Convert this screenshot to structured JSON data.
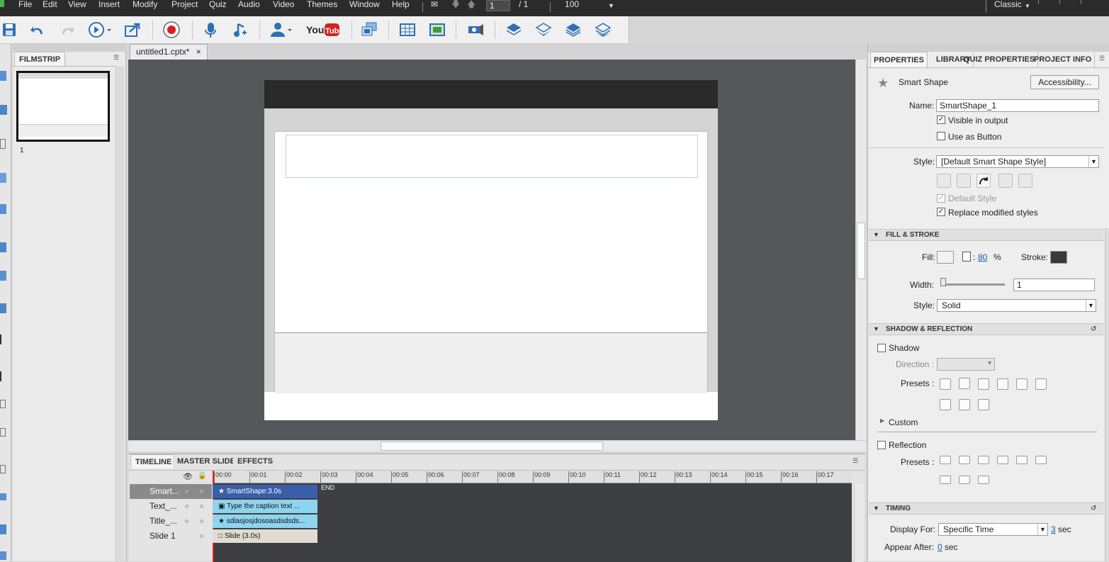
{
  "menubar": {
    "items": [
      "File",
      "Edit",
      "View",
      "Insert",
      "Modify",
      "Project",
      "Quiz",
      "Audio",
      "Video",
      "Themes",
      "Window",
      "Help"
    ],
    "page_current": "1",
    "page_total": "/ 1",
    "zoom": "100",
    "workspace": "Classic"
  },
  "filmstrip": {
    "tab_label": "FILMSTRIP",
    "slide_number": "1"
  },
  "document": {
    "tab_label": "untitled1.cptx*",
    "close_glyph": "×"
  },
  "timeline": {
    "tabs": [
      "TIMELINE",
      "MASTER SLIDE",
      "EFFECTS"
    ],
    "ruler": [
      "00:00",
      "00:01",
      "00:02",
      "00:03",
      "00:04",
      "00:05",
      "00:06",
      "00:07",
      "00:08",
      "00:09",
      "00:10",
      "00:11",
      "00:12",
      "00:13",
      "00:14",
      "00:15",
      "00:16",
      "00:17"
    ],
    "layers": [
      {
        "name": "Smart...",
        "bar": "SmartShape:3.0s"
      },
      {
        "name": "Text_...",
        "bar": "Type the caption text ..."
      },
      {
        "name": "Title_...",
        "bar": "sdiasjosjdosoasdsdsds..."
      },
      {
        "name": "Slide 1",
        "bar": "Slide (3.0s)"
      }
    ],
    "end_label": "END"
  },
  "properties": {
    "tabs": [
      "PROPERTIES",
      "LIBRARY",
      "QUIZ PROPERTIES",
      "PROJECT INFO"
    ],
    "object_type": "Smart Shape",
    "accessibility_button": "Accessibility...",
    "name_label": "Name:",
    "name_value": "SmartShape_1",
    "visible_label": "Visible in output",
    "visible_checked": true,
    "button_label": "Use as Button",
    "button_checked": false,
    "style_label": "Style:",
    "style_value": "[Default Smart Shape Style]",
    "default_style_label": "Default Style",
    "replace_label": "Replace modified styles",
    "fill_stroke": {
      "header": "FILL & STROKE",
      "fill_label": "Fill:",
      "alpha_value": "80",
      "alpha_unit": "%",
      "stroke_label": "Stroke:",
      "width_label": "Width:",
      "width_value": "1",
      "style_label": "Style:",
      "style_value": "Solid"
    },
    "shadow": {
      "header": "SHADOW & REFLECTION",
      "shadow_label": "Shadow",
      "direction_label": "Direction :",
      "presets_label": "Presets :",
      "custom_label": "Custom",
      "reflection_label": "Reflection",
      "reflection_presets_label": "Presets :"
    },
    "timing": {
      "header": "TIMING",
      "display_label": "Display For:",
      "display_value": "Specific Time",
      "duration": "3",
      "sec": "sec",
      "appear_label": "Appear After:",
      "appear_value": "0",
      "appear_sec": "sec"
    }
  },
  "colors": {
    "menubar_bg": "#2b2b2b",
    "stage_bg": "#55575b",
    "timeline_selected": "#3a5ea8",
    "timeline_caption": "#8fd4ef",
    "playhead": "#d22"
  }
}
